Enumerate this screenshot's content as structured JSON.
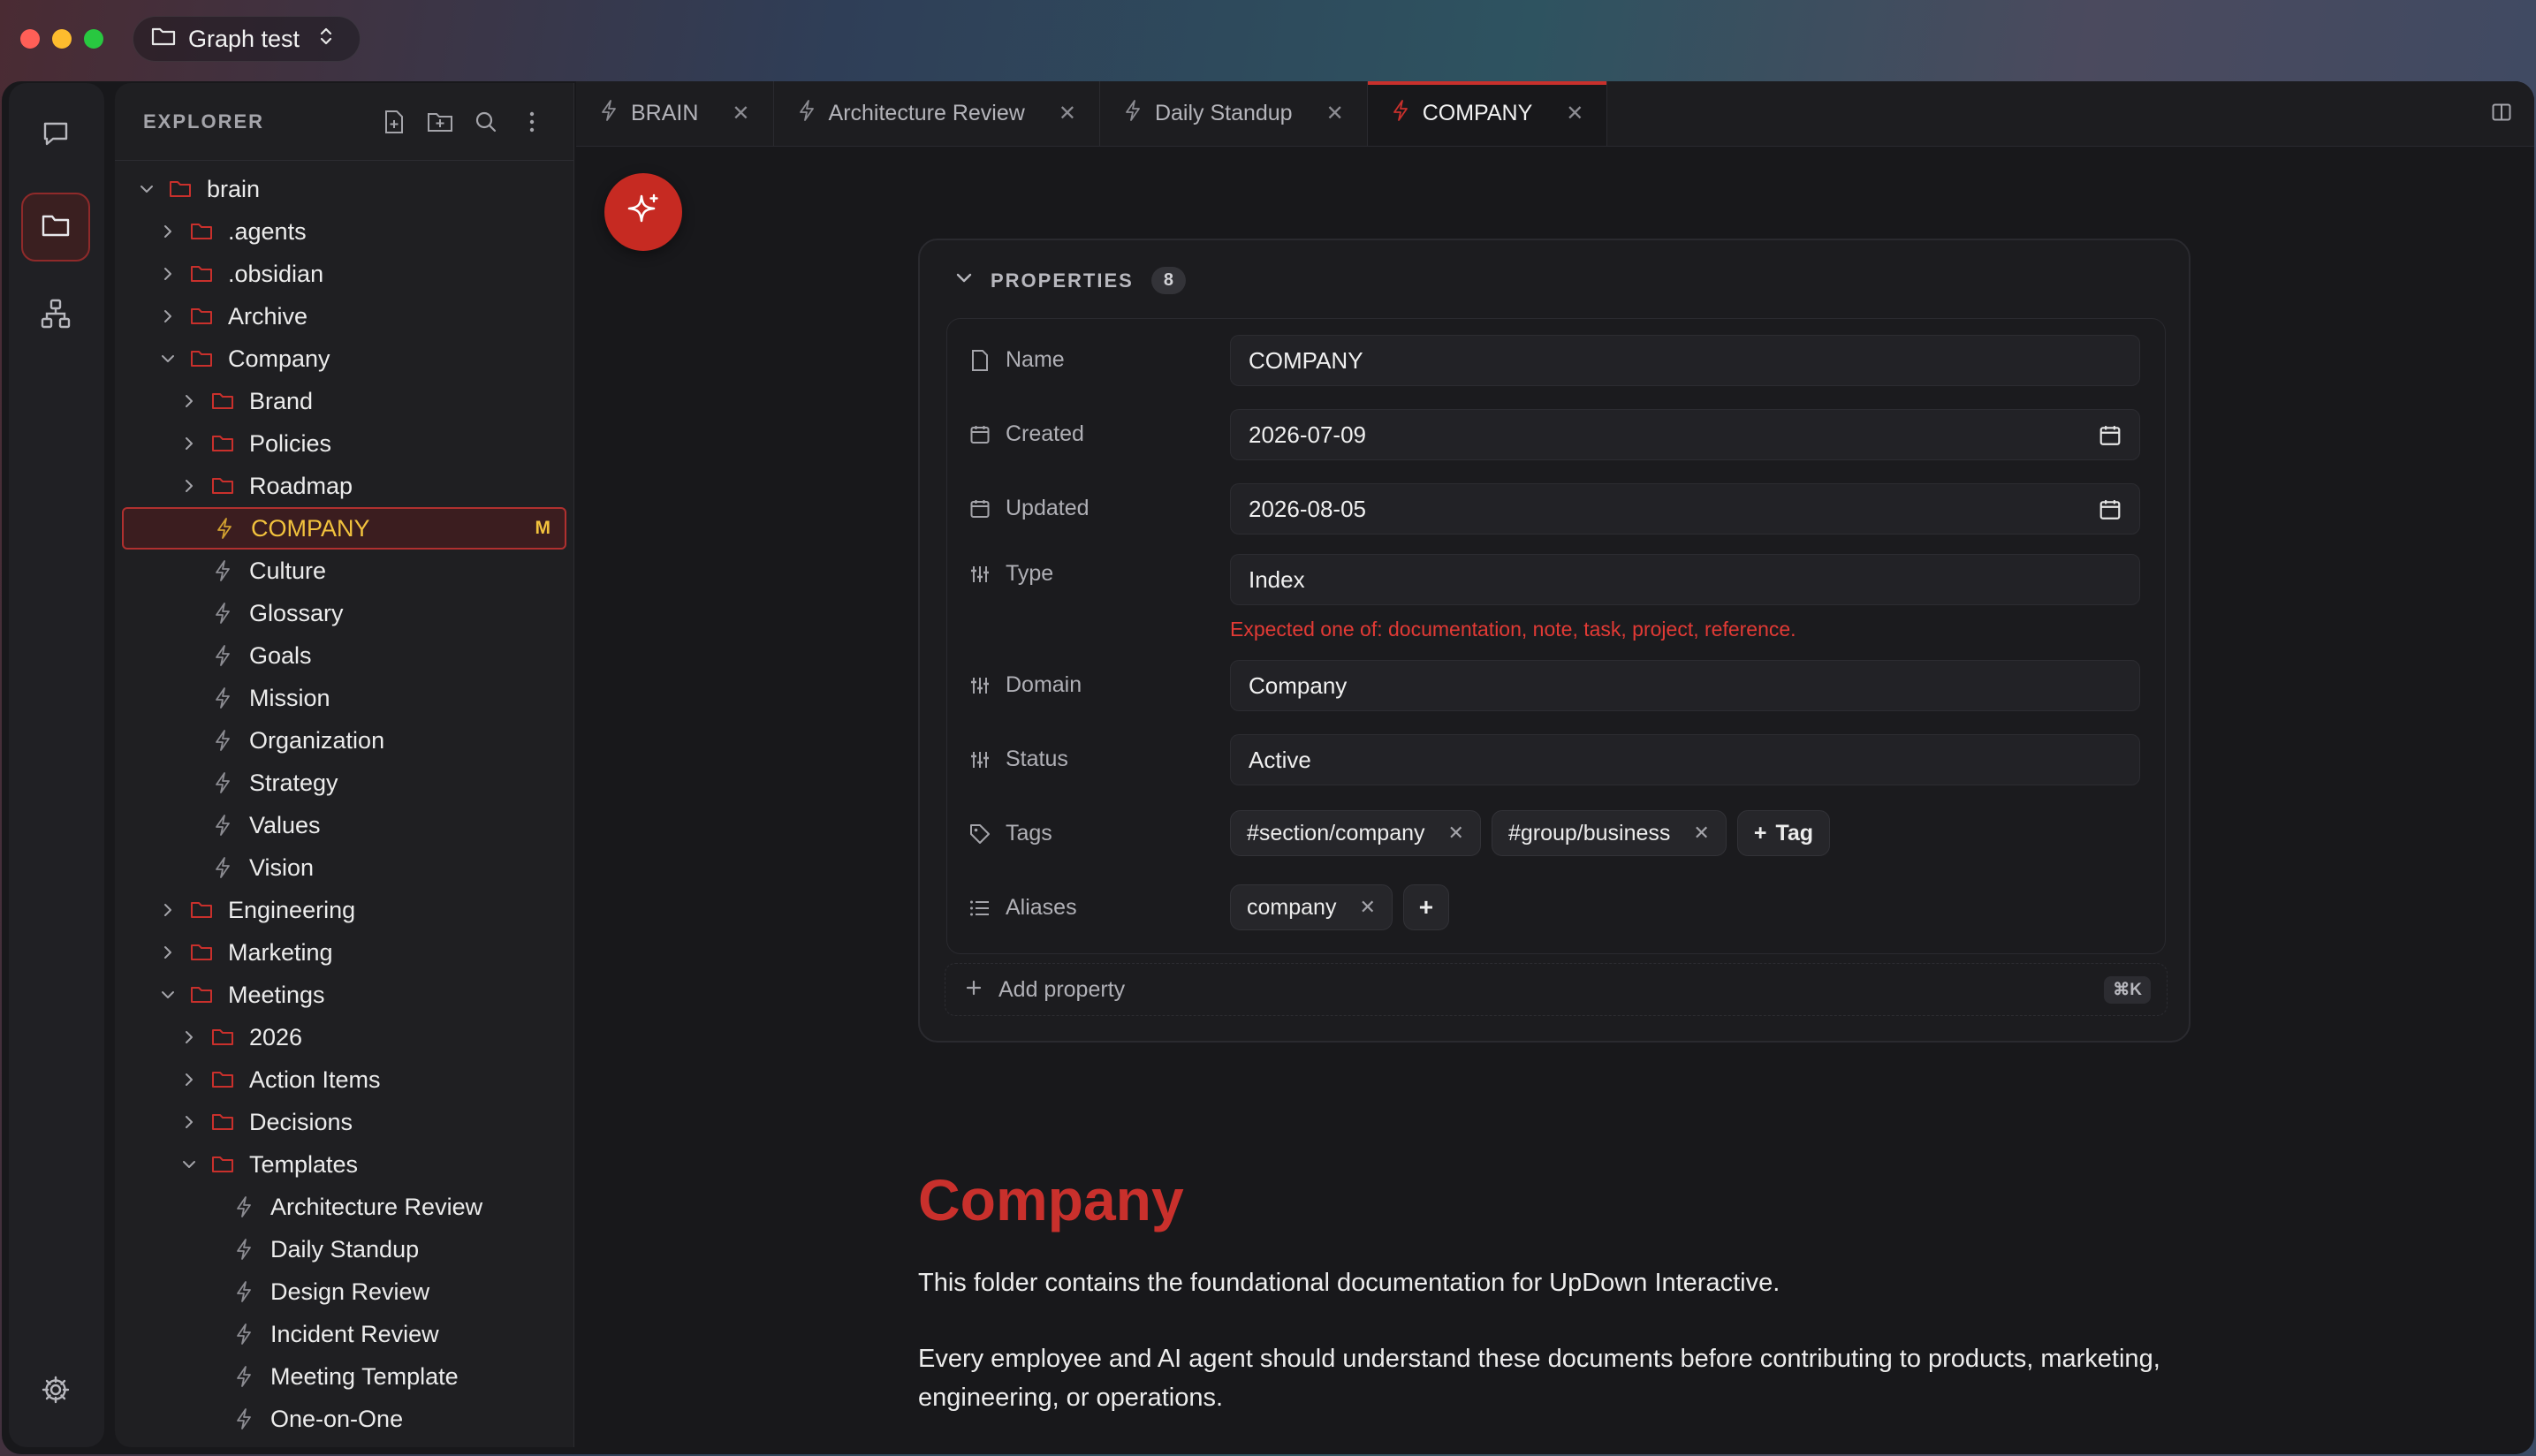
{
  "titlebar": {
    "vault_name": "Graph test"
  },
  "rail": {
    "items": [
      {
        "name": "chat-icon",
        "active": false
      },
      {
        "name": "folder-icon",
        "active": true
      },
      {
        "name": "graph-icon",
        "active": false
      }
    ],
    "settings_icon": "gear-icon"
  },
  "explorer": {
    "title": "EXPLORER",
    "actions": [
      "new-file-icon",
      "new-folder-icon",
      "search-icon",
      "more-icon"
    ],
    "tree": [
      {
        "label": "brain",
        "depth": 0,
        "kind": "folder",
        "expanded": true
      },
      {
        "label": ".agents",
        "depth": 1,
        "kind": "folder",
        "expanded": false
      },
      {
        "label": ".obsidian",
        "depth": 1,
        "kind": "folder",
        "expanded": false
      },
      {
        "label": "Archive",
        "depth": 1,
        "kind": "folder",
        "expanded": false
      },
      {
        "label": "Company",
        "depth": 1,
        "kind": "folder",
        "expanded": true
      },
      {
        "label": "Brand",
        "depth": 2,
        "kind": "folder",
        "expanded": false
      },
      {
        "label": "Policies",
        "depth": 2,
        "kind": "folder",
        "expanded": false
      },
      {
        "label": "Roadmap",
        "depth": 2,
        "kind": "folder",
        "expanded": false
      },
      {
        "label": "COMPANY",
        "depth": 2,
        "kind": "file",
        "selected": true,
        "badge": "M"
      },
      {
        "label": "Culture",
        "depth": 2,
        "kind": "file"
      },
      {
        "label": "Glossary",
        "depth": 2,
        "kind": "file"
      },
      {
        "label": "Goals",
        "depth": 2,
        "kind": "file"
      },
      {
        "label": "Mission",
        "depth": 2,
        "kind": "file"
      },
      {
        "label": "Organization",
        "depth": 2,
        "kind": "file"
      },
      {
        "label": "Strategy",
        "depth": 2,
        "kind": "file"
      },
      {
        "label": "Values",
        "depth": 2,
        "kind": "file"
      },
      {
        "label": "Vision",
        "depth": 2,
        "kind": "file"
      },
      {
        "label": "Engineering",
        "depth": 1,
        "kind": "folder",
        "expanded": false
      },
      {
        "label": "Marketing",
        "depth": 1,
        "kind": "folder",
        "expanded": false
      },
      {
        "label": "Meetings",
        "depth": 1,
        "kind": "folder",
        "expanded": true
      },
      {
        "label": "2026",
        "depth": 2,
        "kind": "folder",
        "expanded": false
      },
      {
        "label": "Action Items",
        "depth": 2,
        "kind": "folder",
        "expanded": false
      },
      {
        "label": "Decisions",
        "depth": 2,
        "kind": "folder",
        "expanded": false
      },
      {
        "label": "Templates",
        "depth": 2,
        "kind": "folder",
        "expanded": true
      },
      {
        "label": "Architecture Review",
        "depth": 3,
        "kind": "file"
      },
      {
        "label": "Daily Standup",
        "depth": 3,
        "kind": "file"
      },
      {
        "label": "Design Review",
        "depth": 3,
        "kind": "file"
      },
      {
        "label": "Incident Review",
        "depth": 3,
        "kind": "file"
      },
      {
        "label": "Meeting Template",
        "depth": 3,
        "kind": "file"
      },
      {
        "label": "One-on-One",
        "depth": 3,
        "kind": "file"
      }
    ]
  },
  "tabs": [
    {
      "label": "BRAIN",
      "active": false
    },
    {
      "label": "Architecture Review",
      "active": false
    },
    {
      "label": "Daily Standup",
      "active": false
    },
    {
      "label": "COMPANY",
      "active": true
    }
  ],
  "properties": {
    "title": "PROPERTIES",
    "count": "8",
    "name": {
      "key": "Name",
      "value": "COMPANY"
    },
    "created": {
      "key": "Created",
      "value": "2026-07-09"
    },
    "updated": {
      "key": "Updated",
      "value": "2026-08-05"
    },
    "type": {
      "key": "Type",
      "value": "Index",
      "error": "Expected one of: documentation, note, task, project, reference."
    },
    "domain": {
      "key": "Domain",
      "value": "Company"
    },
    "status": {
      "key": "Status",
      "value": "Active"
    },
    "tags": {
      "key": "Tags",
      "items": [
        "#section/company",
        "#group/business"
      ],
      "add_label": "Tag"
    },
    "aliases": {
      "key": "Aliases",
      "items": [
        "company"
      ],
      "add_label": "+"
    },
    "add_property": {
      "label": "Add property",
      "shortcut": "⌘K"
    }
  },
  "document": {
    "heading": "Company",
    "paragraphs": [
      "This folder contains the foundational documentation for UpDown Interactive.",
      "Every employee and AI agent should understand these documents before contributing to products, marketing, engineering, or operations."
    ]
  },
  "colors": {
    "accent": "#c9302c",
    "selected_text": "#f2c23d",
    "error": "#e23a35",
    "background": "#18181b"
  }
}
